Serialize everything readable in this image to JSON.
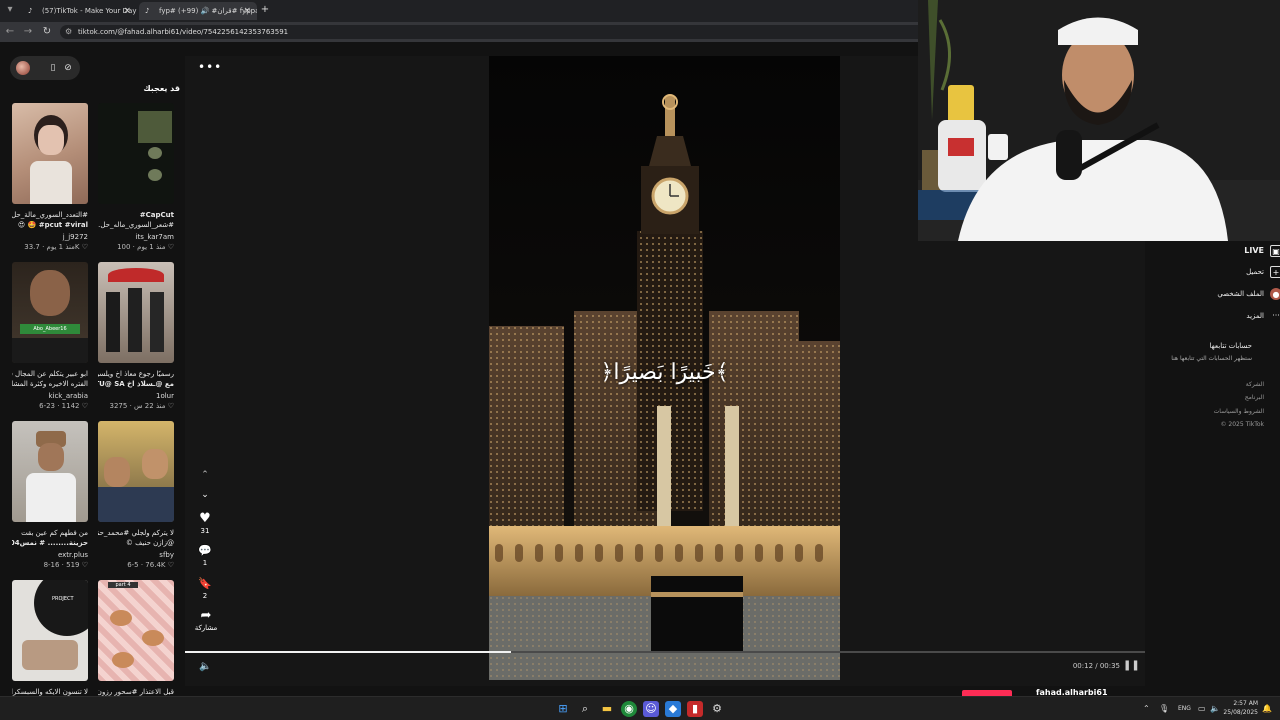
{
  "browser": {
    "tabs": [
      {
        "title": "(57)TikTok - Make Your Day",
        "active": false
      },
      {
        "title": "fyp# قران# 🔊 (99+)# fyppage",
        "active": true
      }
    ],
    "url": "tiktok.com/@fahad.alharbi61/video/7542256142353763591"
  },
  "left_panel": {
    "heading": "قد يعجبك",
    "cards": [
      {
        "line1": "#التعدد_السوري_مالة_حل",
        "line2": "pcut #viral# 🤩 😍",
        "author": "j_j9272",
        "meta": "منذ 1 يوم · 33.7K ♡",
        "thumb_bg": "#c9a58d"
      },
      {
        "line1": "CapCut#",
        "line2": "#شعر_السوري_ماله_حل…",
        "author": "its_kar7am",
        "meta": "منذ 1 يوم · 100 ♡",
        "thumb_bg": "#1d2418"
      },
      {
        "line1": "ابو عبير يتكلم عن المجال في",
        "line2": "الفتره الاخيره وكثرة المشاكل…",
        "author": "kick_arabia",
        "meta": "6-23 · 1142 ♡",
        "thumb_bg": "#3a3026"
      },
      {
        "line1": "رسميًا رجوع معاذ اخ ويلسن",
        "line2": "مع @ـسلاذ اخ TU@ SA…",
        "author": "1olur",
        "meta": "منذ 22 س · 3275 ♡",
        "thumb_bg": "#8a7a6a"
      },
      {
        "line1": "من فطهم كم عين بقت",
        "line2": "حزينة........ # نمس404…",
        "author": "extr.plus",
        "meta": "8-16 · 519 ♡",
        "thumb_bg": "#b7b0a4"
      },
      {
        "line1": "لا يتركم ولجلي #محمد_حنيف",
        "line2": "@زازن حنيف ©",
        "author": "sfby",
        "meta": "6-5 · 76.4K ♡",
        "thumb_bg": "#6e5a3a"
      },
      {
        "line1": "لا تنسون الايكه والسبسكرايب",
        "line2": "",
        "author": "",
        "meta": "",
        "thumb_bg": "#2a2a2a"
      },
      {
        "line1": "قبل الاعتذار #سحور رزون",
        "line2": "",
        "author": "",
        "meta": "",
        "thumb_bg": "#d9a8a2"
      }
    ],
    "card_thumb_labels": [
      "",
      "",
      "Abo_Abeer16",
      "part 4",
      "",
      "",
      "PROJECT",
      "part 4"
    ]
  },
  "video": {
    "overlay_text": "﴿خَبيرًا بَصيرًا﴾",
    "actions": [
      {
        "icon": "heart-icon",
        "glyph": "♥",
        "count": "31"
      },
      {
        "icon": "comment-icon",
        "glyph": "💬",
        "count": "1"
      },
      {
        "icon": "bookmark-icon",
        "glyph": "🔖",
        "count": "2"
      },
      {
        "icon": "share-icon",
        "glyph": "➦",
        "count": "مشاركة"
      }
    ],
    "time": "00:12 / 00:35",
    "progress_fraction": 0.34,
    "author_handle": "fahad.alharbi61"
  },
  "right_sidebar": {
    "items": [
      {
        "label": "LIVE",
        "icon": "live-icon",
        "glyph": "▣"
      },
      {
        "label": "تحميل",
        "icon": "upload-icon",
        "glyph": "+"
      },
      {
        "label": "الملف الشخصي",
        "icon": "profile-icon",
        "glyph": "●"
      },
      {
        "label": "المزيد",
        "icon": "more-icon",
        "glyph": "···"
      }
    ],
    "following_heading": "حسابات تتابعها",
    "following_sub": "ستظهر الحسابات التي تتابعها هنا",
    "footer": [
      "الشركة",
      "البرنامج",
      "الشروط والسياسات",
      "© 2025 TikTok"
    ]
  },
  "taskbar": {
    "lang": "ENG",
    "time": "2:57 AM",
    "date": "25/08/2025"
  }
}
